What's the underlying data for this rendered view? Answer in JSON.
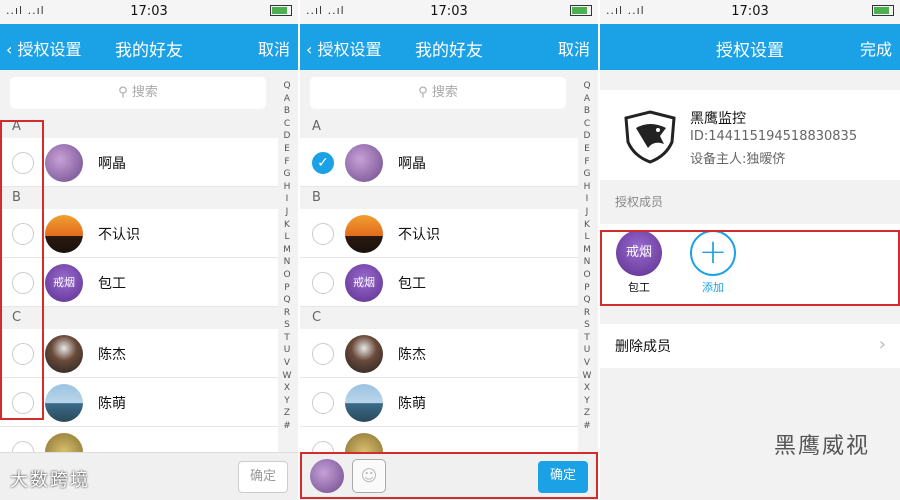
{
  "status": {
    "time": "17:03",
    "signal": "..ıl ..ıl",
    "icons": "⏰ ◔"
  },
  "panel1": {
    "back_label": "授权设置",
    "title": "我的好友",
    "right_label": "取消",
    "search_placeholder": "搜索",
    "sections": [
      {
        "letter": "A",
        "rows": [
          {
            "name": "啊晶",
            "checked": false
          }
        ]
      },
      {
        "letter": "B",
        "rows": [
          {
            "name": "不认识",
            "checked": false
          },
          {
            "name": "包工",
            "checked": false
          }
        ]
      },
      {
        "letter": "C",
        "rows": [
          {
            "name": "陈杰",
            "checked": false
          },
          {
            "name": "陈萌",
            "checked": false
          }
        ]
      }
    ],
    "avatar_overlay_text": "戒烟",
    "confirm_label": "确定"
  },
  "panel2": {
    "back_label": "授权设置",
    "title": "我的好友",
    "right_label": "取消",
    "search_placeholder": "搜索",
    "sections": [
      {
        "letter": "A",
        "rows": [
          {
            "name": "啊晶",
            "checked": true
          }
        ]
      },
      {
        "letter": "B",
        "rows": [
          {
            "name": "不认识",
            "checked": false
          },
          {
            "name": "包工",
            "checked": false
          }
        ]
      },
      {
        "letter": "C",
        "rows": [
          {
            "name": "陈杰",
            "checked": false
          },
          {
            "name": "陈萌",
            "checked": false
          }
        ]
      }
    ],
    "avatar_overlay_text": "戒烟",
    "confirm_label": "确定"
  },
  "index_letters": [
    "Q",
    "A",
    "B",
    "C",
    "D",
    "E",
    "F",
    "G",
    "H",
    "I",
    "J",
    "K",
    "L",
    "M",
    "N",
    "O",
    "P",
    "Q",
    "R",
    "S",
    "T",
    "U",
    "V",
    "W",
    "X",
    "Y",
    "Z",
    "#"
  ],
  "panel3": {
    "title": "授权设置",
    "right_label": "完成",
    "device_name": "黑鹰监控",
    "device_id": "ID:144115194518830835",
    "device_owner": "设备主人:独暧侪",
    "members_label": "授权成员",
    "member_name": "包工",
    "member_avatar_text": "戒烟",
    "add_label": "添加",
    "delete_label": "删除成员"
  },
  "watermarks": {
    "left": "大数跨境",
    "right": "黑鹰威视"
  },
  "colors": {
    "accent": "#1ba1e6",
    "highlight": "#d42b2b"
  }
}
